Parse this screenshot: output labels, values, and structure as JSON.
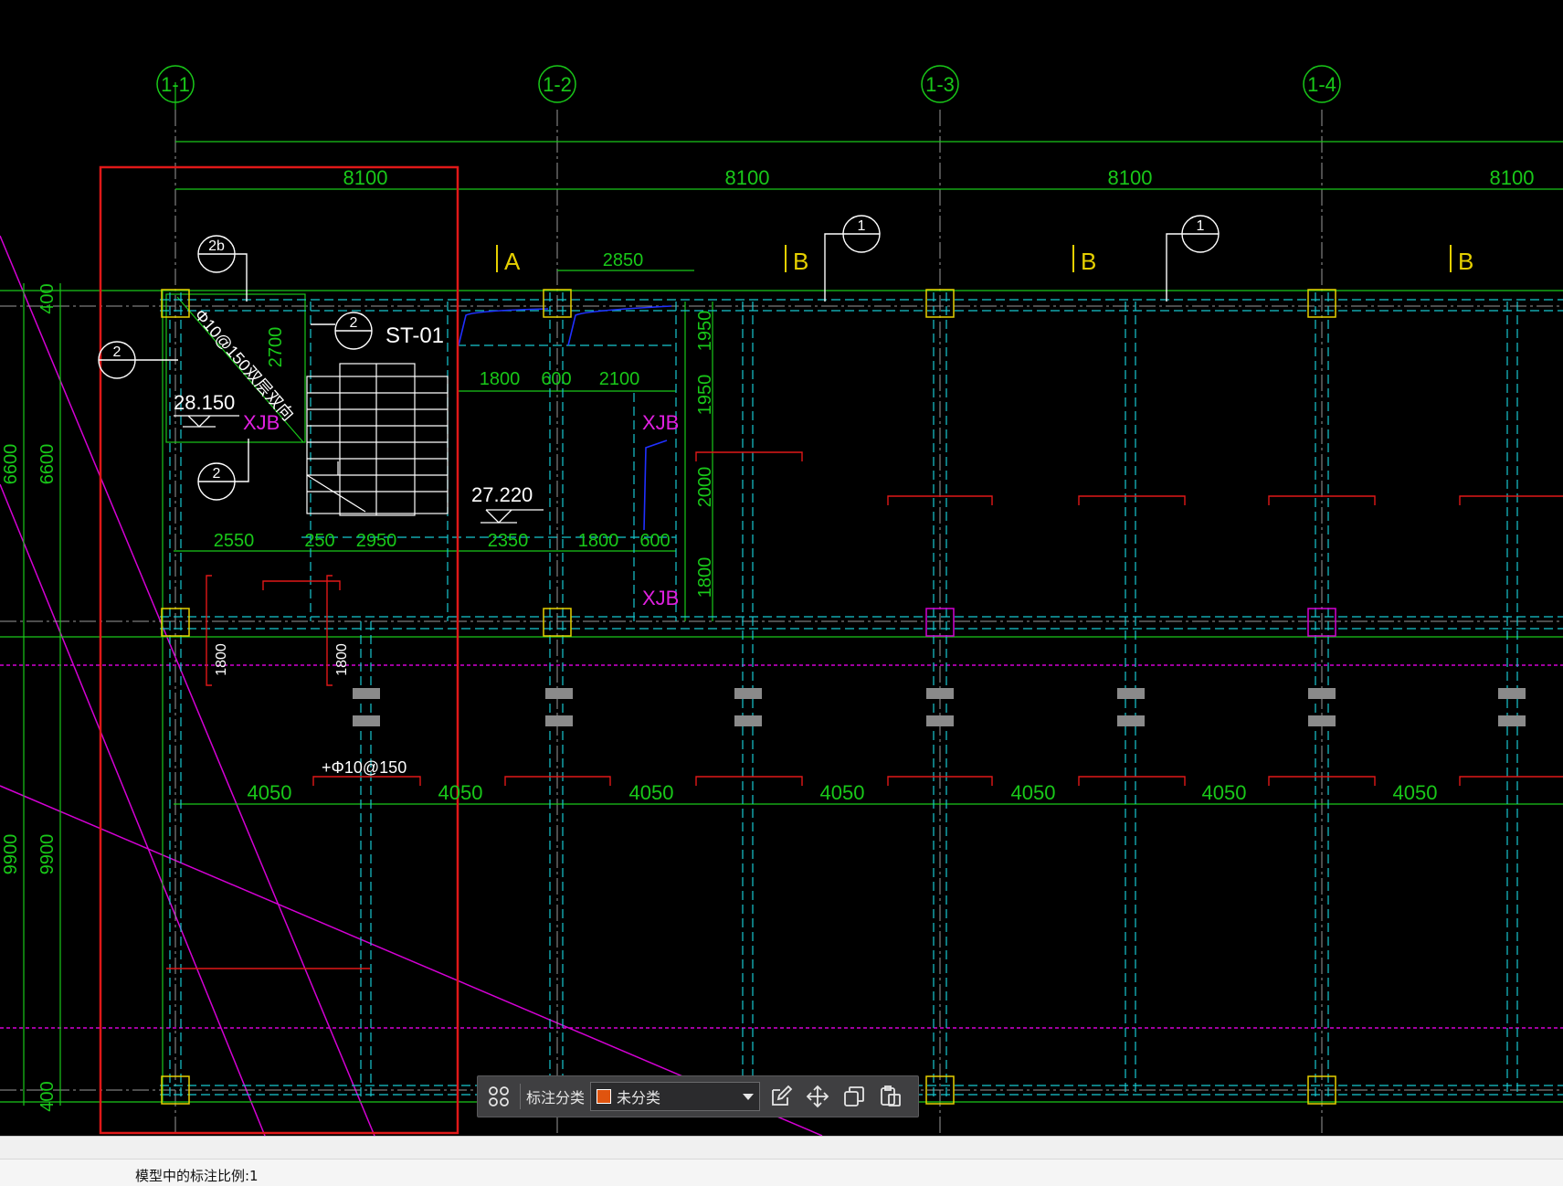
{
  "drawing": {
    "grid_bubbles": [
      "1-1",
      "1-2",
      "1-3",
      "1-4"
    ],
    "span_dims": [
      "8100",
      "8100",
      "8100",
      "8100"
    ],
    "section_marks": [
      "A",
      "B",
      "B",
      "B"
    ],
    "detail_refs": {
      "ref_1a": "1",
      "ref_1b": "1",
      "ref_2b": "2b",
      "ref_2a": "2",
      "ref_2c": "2",
      "ref_2d": "2"
    },
    "stair_label": "ST-01",
    "rebar_note": "Φ10@150双层双向",
    "rebar_note2": "+Φ10@150",
    "xjb": "XJB",
    "elev_1": "28.150",
    "elev_2": "27.220",
    "dims_top": [
      "2850",
      "1800",
      "600",
      "2100",
      "1950",
      "1950",
      "2000",
      "1800",
      "2700"
    ],
    "dims_mid": [
      "2550",
      "250",
      "2950",
      "2350",
      "1800",
      "600"
    ],
    "dims_bottom": [
      "4050",
      "4050",
      "4050",
      "4050",
      "4050",
      "4050",
      "4050"
    ],
    "dims_left": [
      "400",
      "6600",
      "6600",
      "9900",
      "9900",
      "400"
    ],
    "dims_red": [
      "1800",
      "1800"
    ]
  },
  "toolbar": {
    "category_label": "标注分类",
    "category_value": "未分类",
    "swatch_color": "#e0540f"
  },
  "status": {
    "message": "模型中的标注比例:1"
  }
}
